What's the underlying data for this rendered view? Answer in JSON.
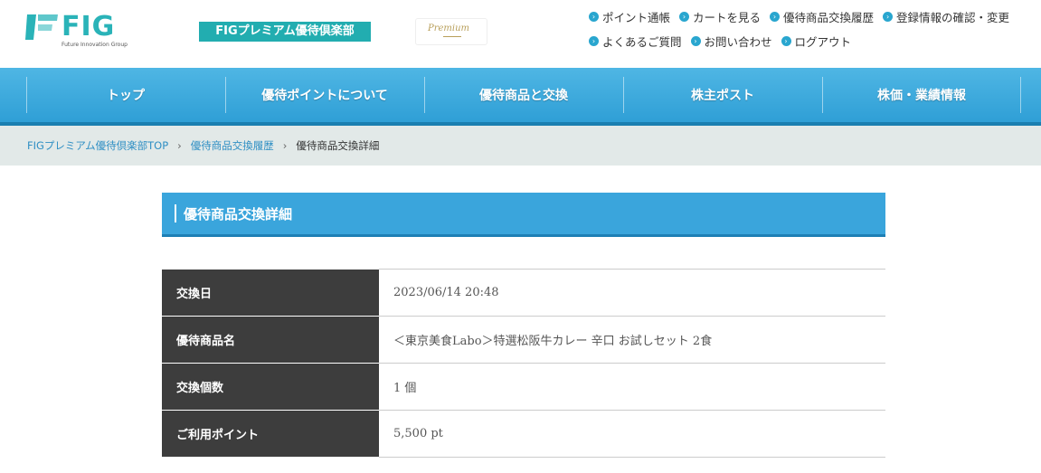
{
  "logo": {
    "name": "FIG",
    "tagline": "Future Innovation Group"
  },
  "header": {
    "club_badge": "FIGプレミアム優待倶楽部",
    "premium_logo_text": "Premium"
  },
  "util_nav": {
    "row1": [
      "ポイント通帳",
      "カートを見る",
      "優待商品交換履歴",
      "登録情報の確認・変更"
    ],
    "row2": [
      "よくあるご質問",
      "お問い合わせ",
      "ログアウト"
    ]
  },
  "global_nav": [
    "トップ",
    "優待ポイントについて",
    "優待商品と交換",
    "株主ポスト",
    "株価・業績情報"
  ],
  "breadcrumb": {
    "items": [
      "FIGプレミアム優待倶楽部TOP",
      "優待商品交換履歴"
    ],
    "current": "優待商品交換詳細",
    "separator": "›"
  },
  "section": {
    "title": "優待商品交換詳細"
  },
  "details": {
    "rows": [
      {
        "label": "交換日",
        "value": "2023/06/14 20:48"
      },
      {
        "label": "優待商品名",
        "value": "＜東京美食Labo＞特選松阪牛カレー 辛口 お試しセット 2食"
      },
      {
        "label": "交換個数",
        "value": "1 個"
      },
      {
        "label": "ご利用ポイント",
        "value": "5,500 pt"
      }
    ]
  },
  "colors": {
    "brand_teal": "#2ab3b8",
    "nav_blue": "#3aa5dc",
    "nav_blue_dark": "#1e7fb5",
    "table_header": "#3d3d3d",
    "breadcrumb_bg": "#e2e9e8",
    "link_blue": "#2f8fc4"
  }
}
